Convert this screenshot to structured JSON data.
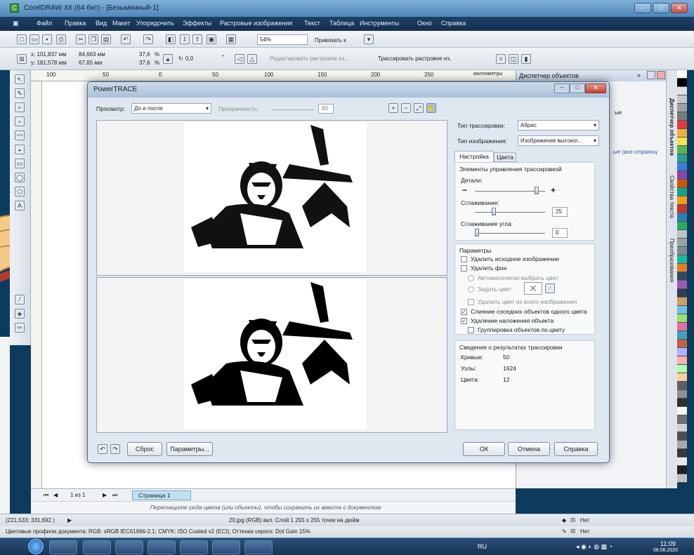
{
  "window": {
    "title": "CorelDRAW X6 (64 бит) - [Безымянный-1]",
    "app_icon": "corel-icon",
    "min": "–",
    "max": "□",
    "close": "✕"
  },
  "menu": [
    "Файл",
    "Правка",
    "Вид",
    "Макет",
    "Упорядочить",
    "Эффекты",
    "Растровые изображения",
    "Текст",
    "Таблица",
    "Инструменты",
    "Окно",
    "Справка"
  ],
  "toolbar": {
    "zoom": "54%",
    "snap_label": "Привязать к"
  },
  "propbar": {
    "x": "x: 101,837 мм",
    "y": "y: 181,578 мм",
    "w": "84,663 мм",
    "h": "67,65 мм",
    "sx": "37,6",
    "sy": "37,6",
    "pct1": "%",
    "pct2": "%",
    "angle": "0,0",
    "deg": "°",
    "edit_bitmap": "Редактировать растровое из...",
    "trace_bitmap": "Трассировать растровое из."
  },
  "ruler": {
    "units": "миллиметры",
    "ticks": [
      "100",
      "50",
      "0",
      "50",
      "100",
      "150",
      "200",
      "250"
    ]
  },
  "object_manager": {
    "title": "Диспетчер объектов",
    "partial1": "ые",
    "partial2": "ые (все страниц"
  },
  "dock_tabs": [
    "Диспетчер объектов",
    "Свойства текста",
    "Преобразования"
  ],
  "dialog": {
    "title": "PowerTRACE",
    "preview_label": "Просмотр:",
    "preview_value": "До и после",
    "transparency_label": "Прозрачность:",
    "transparency_value": "80",
    "trace_type_label": "Тип трассировки:",
    "trace_type_value": "Абрис",
    "image_type_label": "Тип изображения:",
    "image_type_value": "Изображение высоког...",
    "tabs": [
      "Настройка",
      "Цвета"
    ],
    "controls_group": "Элементы управления трассировкой",
    "detail_label": "Детали:",
    "smoothing_label": "Сглаживание:",
    "smoothing_value": "25",
    "corner_label": "Сглаживание угла:",
    "corner_value": "0",
    "params_group": "Параметры",
    "opt_remove_source": "Удалить исходное изображение",
    "opt_remove_bg": "Удалить фон",
    "opt_auto_color": "Автоматически выбрать цвет",
    "opt_set_color": "Задать цвет:",
    "opt_remove_color_all": "Удалить цвет из всего изображения",
    "opt_merge": "Слияние соседних объектов одного цвета",
    "opt_overlap": "Удаление наложения объекта",
    "opt_group": "Группировка объектов по цвету",
    "results_group": "Сведения о результатах трассировки",
    "curves_label": "Кривые:",
    "curves_value": "50",
    "nodes_label": "Узлы:",
    "nodes_value": "1624",
    "colors_label": "Цвета:",
    "colors_value": "12",
    "reset": "Сброс",
    "options": "Параметры...",
    "ok": "ОК",
    "cancel": "Отмена",
    "help": "Справка",
    "checked": {
      "remove_source": false,
      "remove_bg": false,
      "merge": true,
      "overlap": true,
      "group": false
    },
    "detail_level": 0.88
  },
  "pagebar": {
    "page_count": "1 из 1",
    "page_tab": "Страница 1"
  },
  "hint": "Перетащите сюда цвета (или объекты), чтобы сохранить их вместе с документом",
  "status": {
    "coords": "(221,533; 331,692 )",
    "info": "20.jpg (RGB) вкл. Слой 1 255 x 255 точек на дюйм",
    "fill_none": "Нет",
    "outline_none": "Нет",
    "profiles": "Цветовые профили документа: RGB: sRGB IEC61966-2.1; CMYK: ISO Coated v2 (ECI); Оттенки серого: Dot Gain 15%"
  },
  "taskbar": {
    "lang": "RU",
    "time": "11:09",
    "date": "08.06.2020"
  },
  "palette": [
    "#ffffff",
    "#000000",
    "#e1e1e1",
    "#c8c8c8",
    "#a0a0a0",
    "#7a7a7a",
    "#e33b3b",
    "#f0b23a",
    "#f7e24a",
    "#58b34b",
    "#2a9d8f",
    "#3b7dd8",
    "#8e44ad",
    "#d35400",
    "#16a085",
    "#f39c12",
    "#c0392b",
    "#2980b9",
    "#27ae60",
    "#bdc3c7",
    "#95a5a6",
    "#7f8c8d",
    "#1abc9c",
    "#e67e22",
    "#34495e",
    "#9b59b6",
    "#2c3e50",
    "#d0a060",
    "#70c0e0",
    "#a0e070",
    "#e070a0",
    "#40a0c0",
    "#c06040",
    "#b0b0ff",
    "#ffb0b0",
    "#b0ffb0",
    "#ffd0a0",
    "#606060",
    "#909090",
    "#303030",
    "#f8f8f8",
    "#707070",
    "#d0d0d0",
    "#505050",
    "#a8a8a8",
    "#383838",
    "#e8e8e8",
    "#202020",
    "#c0c0c0"
  ]
}
